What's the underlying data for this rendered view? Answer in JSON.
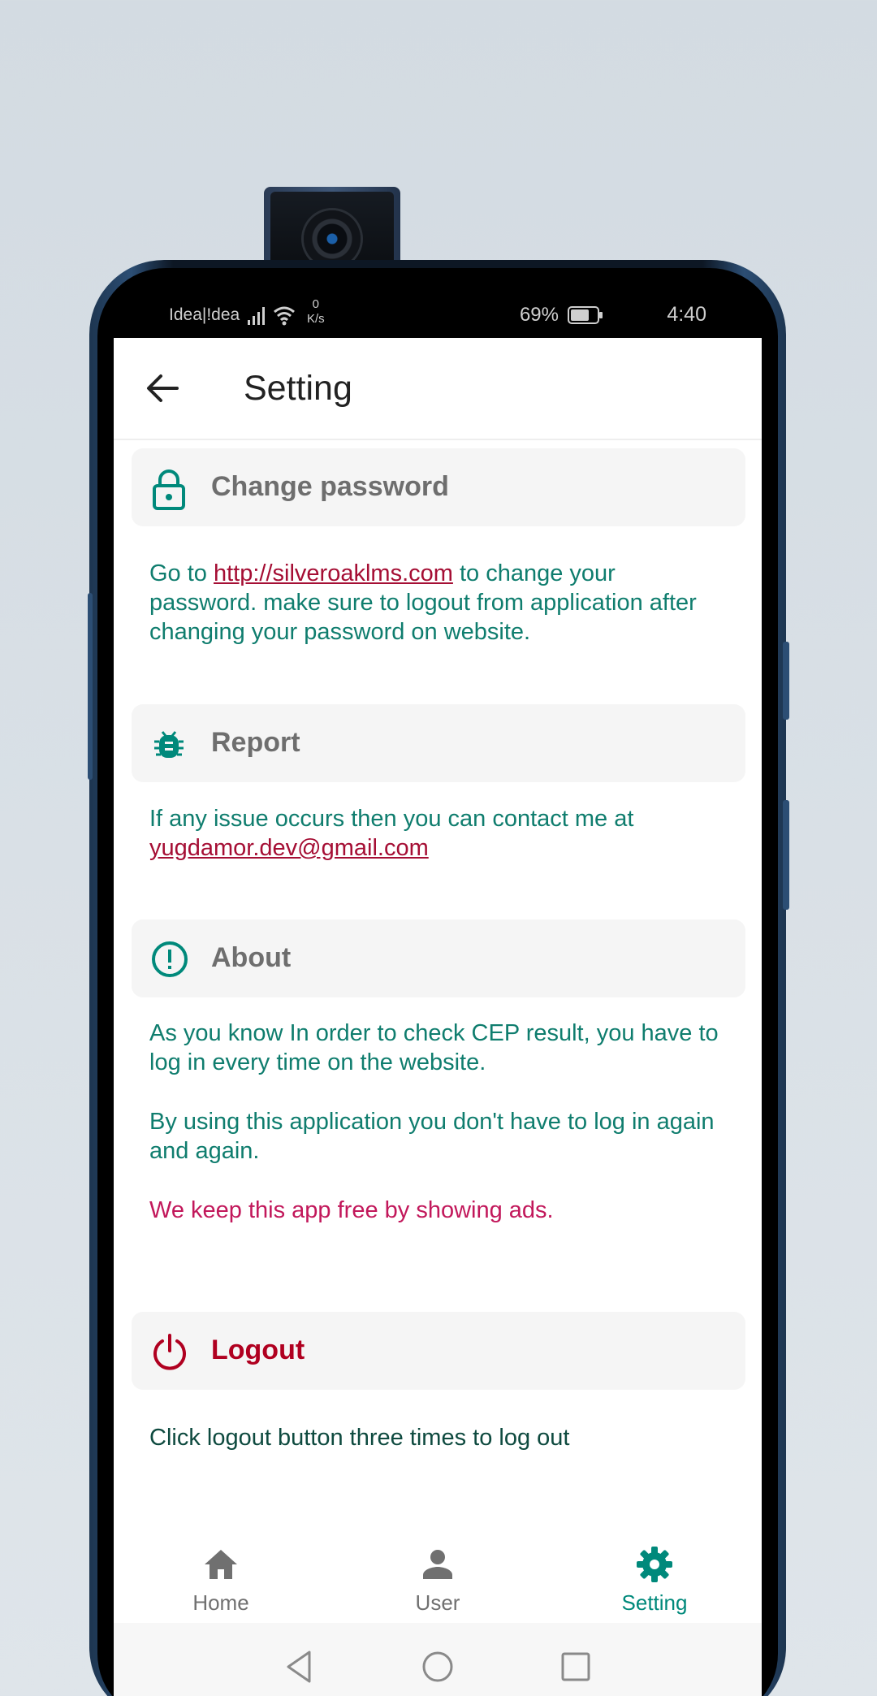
{
  "status_bar": {
    "carrier": "Idea|!dea",
    "net_speed_value": "0",
    "net_speed_unit": "K/s",
    "battery_percent": "69%",
    "time": "4:40"
  },
  "app_bar": {
    "title": "Setting"
  },
  "sections": {
    "change_password": {
      "title": "Change password",
      "text_before_link": "Go to ",
      "link": "http://silveroaklms.com",
      "text_after_link": " to change your password. make sure to logout from application after changing your password on website."
    },
    "report": {
      "title": "Report",
      "text_before_link": "If any issue occurs then you can contact me at ",
      "email": "yugdamor.dev@gmail.com"
    },
    "about": {
      "title": "About",
      "paragraph1": "As you know In order to check CEP result, you have to log in every time on the website.",
      "paragraph2": "By using this application you don't have to log in again and again.",
      "ads_note": "We keep this app free by showing ads."
    },
    "logout": {
      "title": "Logout",
      "text": "Click logout button three times to log out"
    }
  },
  "bottom_nav": {
    "items": [
      {
        "label": "Home",
        "icon": "home-icon"
      },
      {
        "label": "User",
        "icon": "user-icon"
      },
      {
        "label": "Setting",
        "icon": "gear-icon",
        "active": true
      }
    ]
  },
  "colors": {
    "accent": "#00897b",
    "body_text": "#0f7d6e",
    "link": "#a50e34",
    "logout": "#b00020",
    "ads": "#c2185b"
  }
}
